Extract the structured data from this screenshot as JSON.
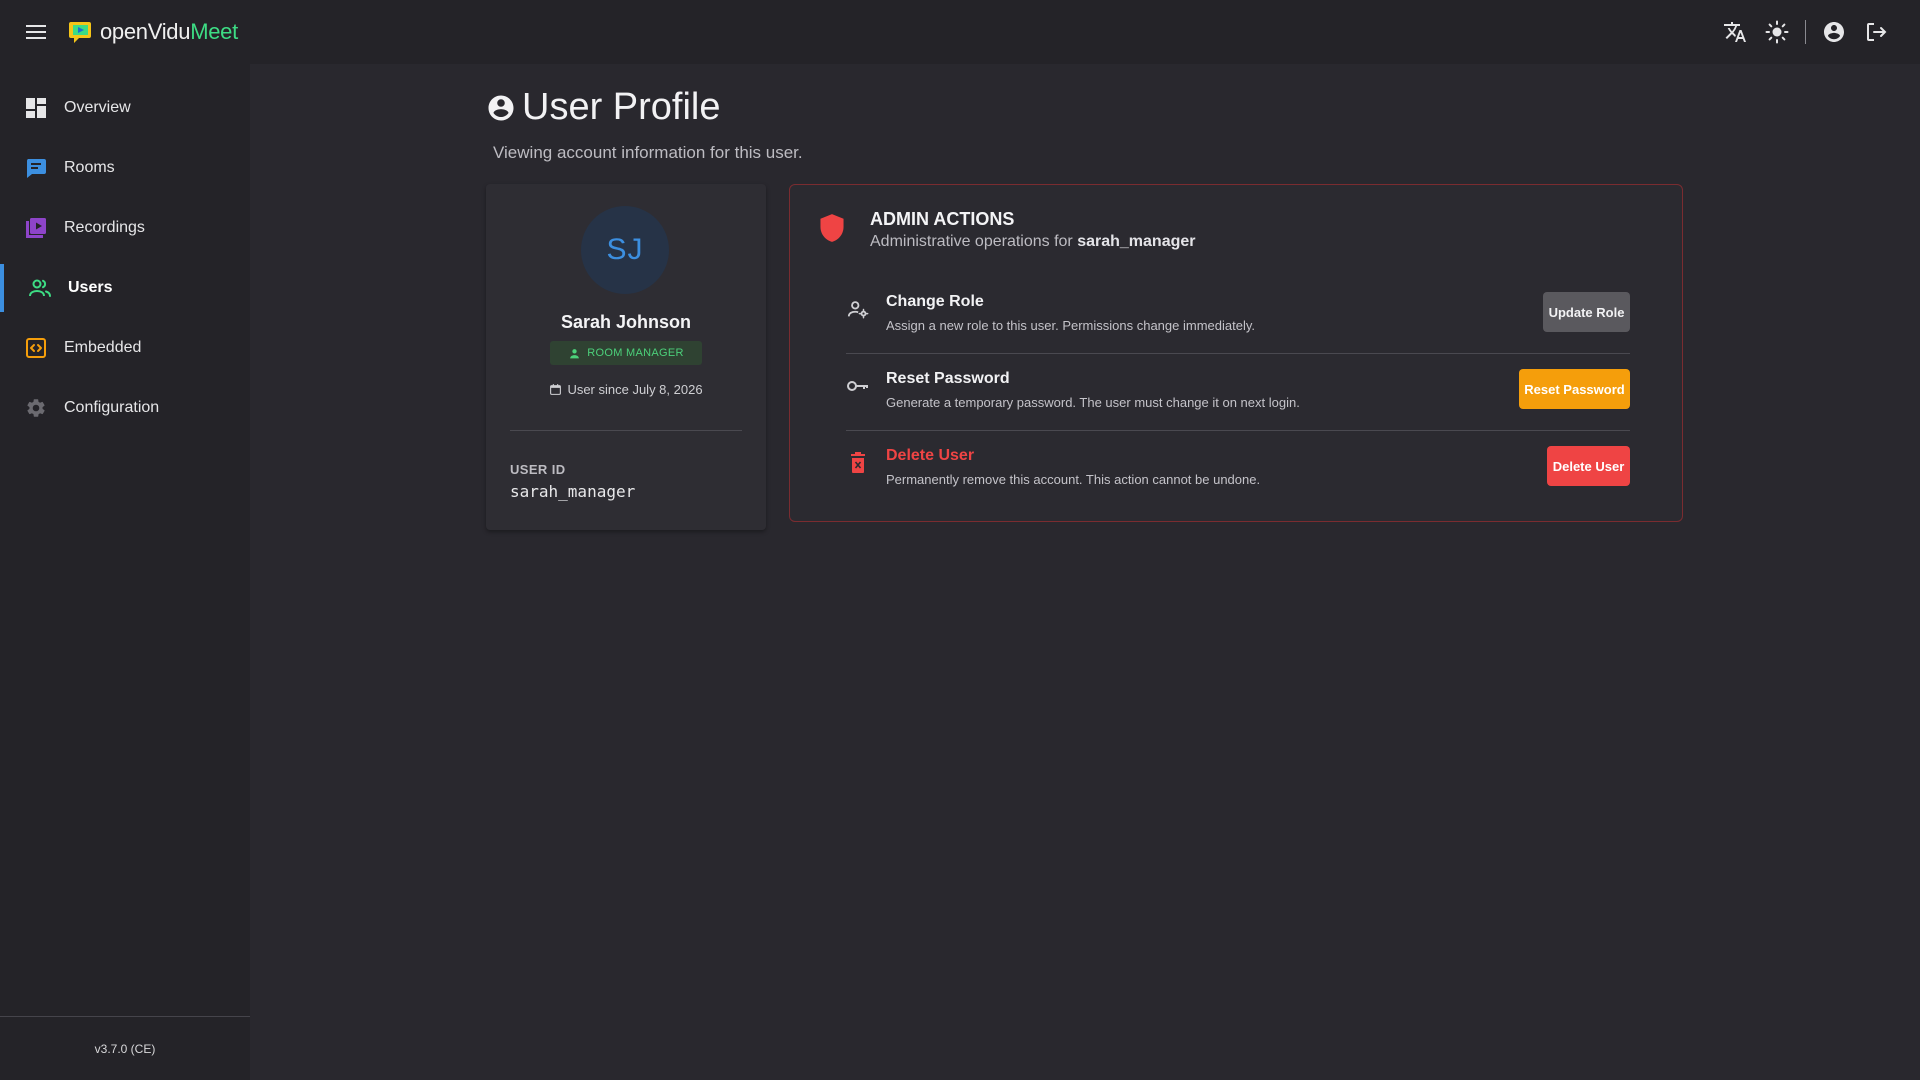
{
  "app": {
    "logo_brand": "openVidu",
    "logo_product": "Meet",
    "version": "v3.7.0 (CE)"
  },
  "topbar": {
    "icons": [
      "menu-icon",
      "translate-icon",
      "theme-light-icon",
      "account-circle-icon",
      "logout-icon"
    ]
  },
  "sidebar": {
    "items": [
      {
        "label": "Overview",
        "icon": "dashboard-icon",
        "color": "#e6e6e8",
        "active": false
      },
      {
        "label": "Rooms",
        "icon": "chat-icon",
        "color": "#3c8fe0",
        "active": false
      },
      {
        "label": "Recordings",
        "icon": "video-library-icon",
        "color": "#8e44c9",
        "active": false
      },
      {
        "label": "Users",
        "icon": "group-icon",
        "color": "#3ddc84",
        "active": true
      },
      {
        "label": "Embedded",
        "icon": "code-icon",
        "color": "#f59e0b",
        "active": false
      },
      {
        "label": "Configuration",
        "icon": "settings-icon",
        "color": "#6b6a70",
        "active": false
      }
    ]
  },
  "page": {
    "title": "User Profile",
    "subtitle": "Viewing account information for this user."
  },
  "profile": {
    "initials": "SJ",
    "full_name": "Sarah Johnson",
    "role": "ROOM MANAGER",
    "since": "User since July 8, 2026",
    "user_id_label": "USER ID",
    "user_id": "sarah_manager"
  },
  "admin": {
    "title": "ADMIN ACTIONS",
    "subtitle_prefix": "Administrative operations for ",
    "subtitle_user": "sarah_manager",
    "actions": [
      {
        "title": "Change Role",
        "description": "Assign a new role to this user. Permissions change immediately.",
        "button": "Update Role"
      },
      {
        "title": "Reset Password",
        "description": "Generate a temporary password. The user must change it on next login.",
        "button": "Reset Password"
      },
      {
        "title": "Delete User",
        "description": "Permanently remove this account. This action cannot be undone.",
        "button": "Delete User"
      }
    ]
  },
  "colors": {
    "accent_blue": "#3c8fe0",
    "success_green": "#3ddc84",
    "warning_orange": "#f59e0b",
    "danger_red": "#ef4444"
  }
}
